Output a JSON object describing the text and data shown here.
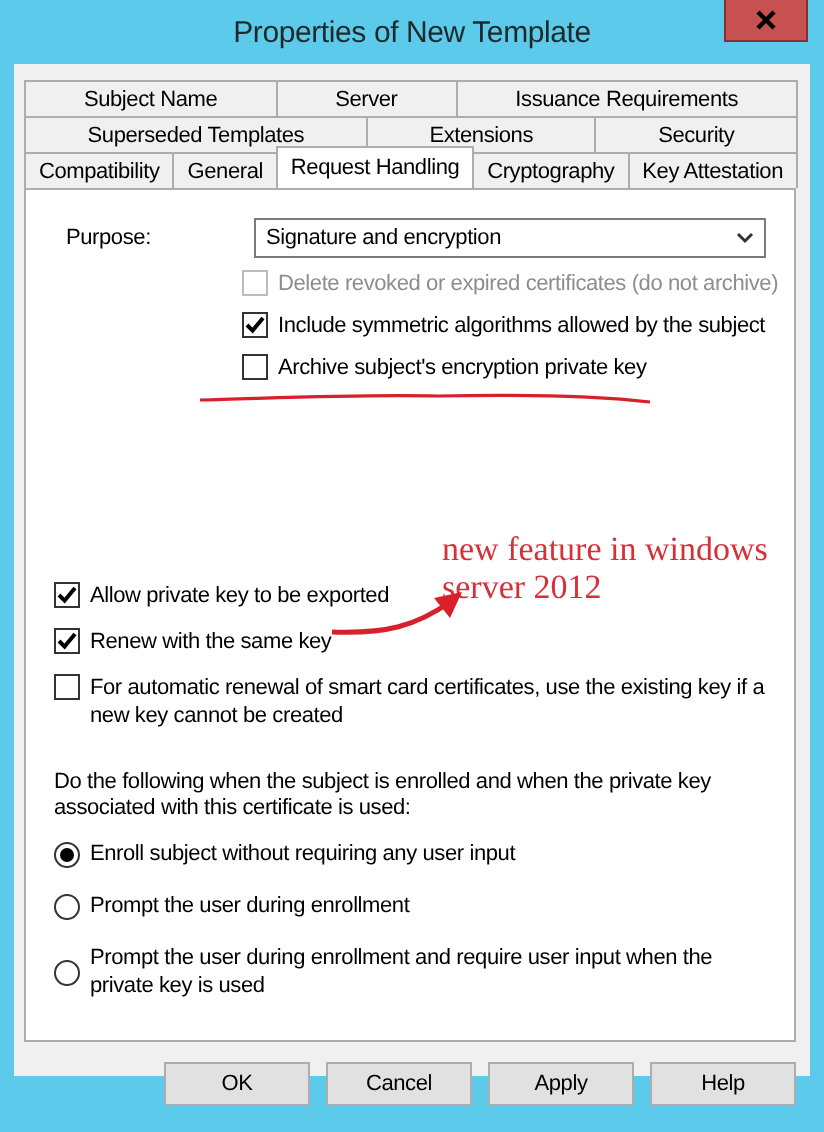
{
  "window": {
    "title": "Properties of New Template"
  },
  "tab_rows": [
    [
      {
        "label": "Subject Name",
        "selected": false
      },
      {
        "label": "Server",
        "selected": false
      },
      {
        "label": "Issuance Requirements",
        "selected": false
      }
    ],
    [
      {
        "label": "Superseded Templates",
        "selected": false
      },
      {
        "label": "Extensions",
        "selected": false
      },
      {
        "label": "Security",
        "selected": false
      }
    ],
    [
      {
        "label": "Compatibility",
        "selected": false
      },
      {
        "label": "General",
        "selected": false
      },
      {
        "label": "Request Handling",
        "selected": true
      },
      {
        "label": "Cryptography",
        "selected": false
      },
      {
        "label": "Key Attestation",
        "selected": false
      }
    ]
  ],
  "purpose": {
    "label": "Purpose:",
    "value": "Signature and encryption"
  },
  "purpose_options": [
    {
      "label": "Delete revoked or expired certificates (do not archive)",
      "checked": false,
      "disabled": true
    },
    {
      "label": "Include symmetric algorithms allowed by the subject",
      "checked": true,
      "disabled": false
    },
    {
      "label": "Archive subject's encryption private key",
      "checked": false,
      "disabled": false
    }
  ],
  "key_options": [
    {
      "label": "Allow private key to be exported",
      "checked": true,
      "disabled": false
    },
    {
      "label": "Renew with the same key",
      "checked": true,
      "disabled": false
    },
    {
      "label": "For automatic renewal of smart card certificates, use the existing key if a new key cannot be created",
      "checked": false,
      "disabled": false
    }
  ],
  "enrollment": {
    "prompt": "Do the following when the subject is enrolled and when the private key associated with this certificate is used:",
    "options": [
      {
        "label": "Enroll subject without requiring any user input",
        "selected": true
      },
      {
        "label": "Prompt the user during enrollment",
        "selected": false
      },
      {
        "label": "Prompt the user during enrollment and require user input when the private key is used",
        "selected": false
      }
    ]
  },
  "annotation": {
    "text": "new feature in windows server 2012"
  },
  "buttons": [
    {
      "label": "OK"
    },
    {
      "label": "Cancel"
    },
    {
      "label": "Apply"
    },
    {
      "label": "Help"
    }
  ]
}
